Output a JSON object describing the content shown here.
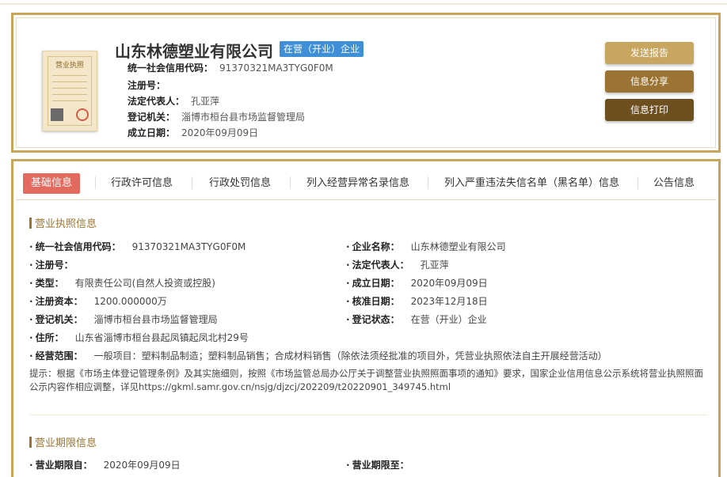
{
  "company": {
    "name": "山东林德塑业有限公司",
    "status_tag": "在营（开业）企业",
    "license_image_title": "营业执照"
  },
  "header_fields": [
    {
      "label": "统一社会信用代码：",
      "value": "91370321MA3TYG0F0M"
    },
    {
      "label": "注册号：",
      "value": ""
    },
    {
      "label": "法定代表人：",
      "value": "孔亚萍"
    },
    {
      "label": "登记机关：",
      "value": "淄博市桓台县市场监督管理局"
    },
    {
      "label": "成立日期：",
      "value": "2020年09月09日"
    }
  ],
  "buttons": {
    "report": "发送报告",
    "share": "信息分享",
    "print": "信息打印"
  },
  "tabs": [
    "基础信息",
    "行政许可信息",
    "行政处罚信息",
    "列入经营异常名录信息",
    "列入严重违法失信名单（黑名单）信息",
    "公告信息"
  ],
  "license_section": {
    "title": "营业执照信息",
    "left": [
      {
        "label": "统一社会信用代码：",
        "value": "91370321MA3TYG0F0M"
      },
      {
        "label": "注册号：",
        "value": ""
      },
      {
        "label": "类型：",
        "value": "有限责任公司(自然人投资或控股)"
      },
      {
        "label": "注册资本：",
        "value": "1200.000000万"
      },
      {
        "label": "登记机关：",
        "value": "淄博市桓台县市场监督管理局"
      },
      {
        "label": "住所：",
        "value": "山东省淄博市桓台县起凤镇起凤北村29号"
      },
      {
        "label": "经营范围：",
        "value": "一般项目：塑料制品制造；塑料制品销售；合成材料销售（除依法须经批准的项目外，凭营业执照依法自主开展经营活动）"
      }
    ],
    "right": [
      {
        "label": "企业名称：",
        "value": "山东林德塑业有限公司"
      },
      {
        "label": "法定代表人：",
        "value": "孔亚萍"
      },
      {
        "label": "成立日期：",
        "value": "2020年09月09日"
      },
      {
        "label": "核准日期：",
        "value": "2023年12月18日"
      },
      {
        "label": "登记状态：",
        "value": "在营（开业）企业"
      }
    ],
    "note": "提示：根据《市场主体登记管理条例》及其实施细则，按照《市场监管总局办公厅关于调整营业执照照面事项的通知》要求，国家企业信用信息公示系统将营业执照照面公示内容作相应调整，详见https://gkml.samr.gov.cn/nsjg/djzcj/202209/t20220901_349745.html"
  },
  "term_section": {
    "title": "营业期限信息",
    "from_label": "营业期限自：",
    "from_value": "2020年09月09日",
    "to_label": "营业期限至：",
    "to_value": ""
  },
  "bullet": "·"
}
